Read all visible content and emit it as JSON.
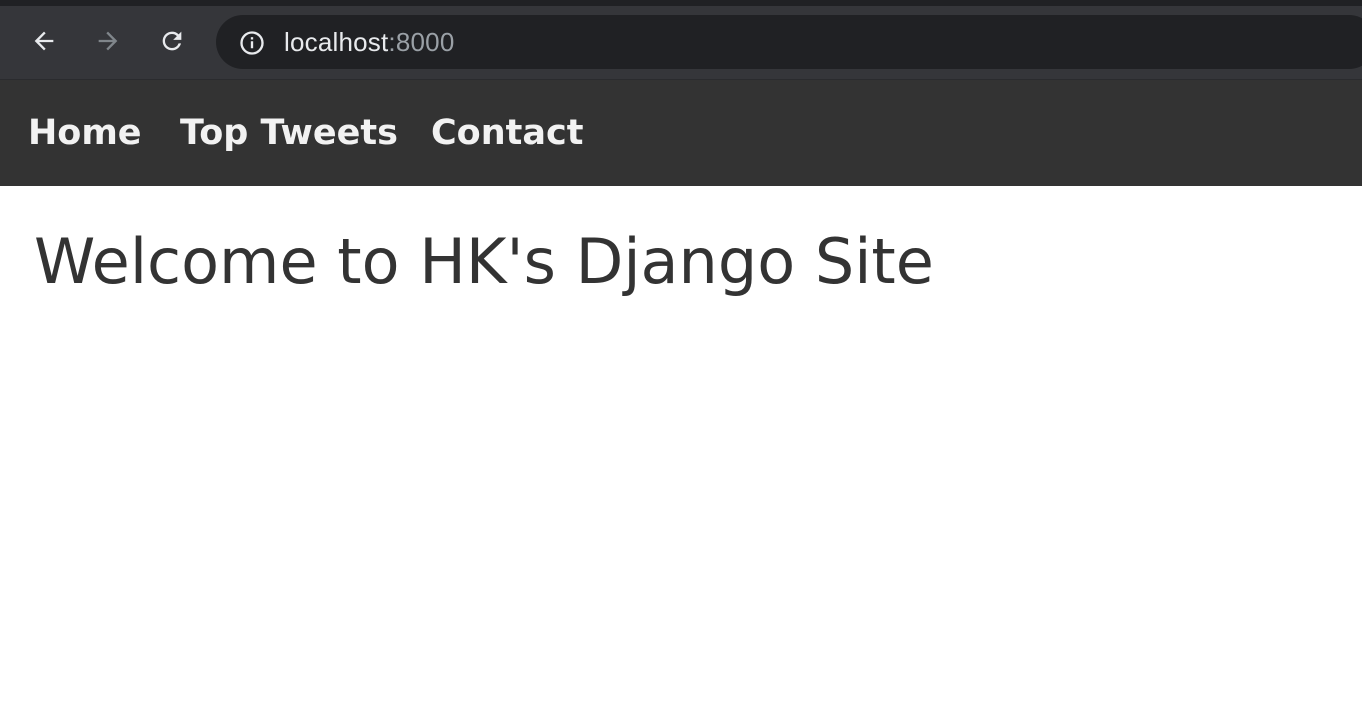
{
  "browser": {
    "back_icon": "arrow-left-icon",
    "forward_icon": "arrow-right-icon",
    "reload_icon": "reload-icon",
    "site_info_icon": "info-icon",
    "address": {
      "host": "localhost",
      "port": ":8000"
    },
    "colors": {
      "chrome_background": "#35363a",
      "omnibox_background": "#202124",
      "active_icon": "#e8eaed",
      "disabled_icon": "#80868b"
    }
  },
  "site_nav": {
    "links": [
      {
        "label": "Home"
      },
      {
        "label": "Top Tweets"
      },
      {
        "label": "Contact"
      }
    ],
    "colors": {
      "background": "#333333",
      "link": "#f2f2f2"
    }
  },
  "main": {
    "heading": "Welcome to HK's Django Site",
    "heading_color": "#333333"
  }
}
